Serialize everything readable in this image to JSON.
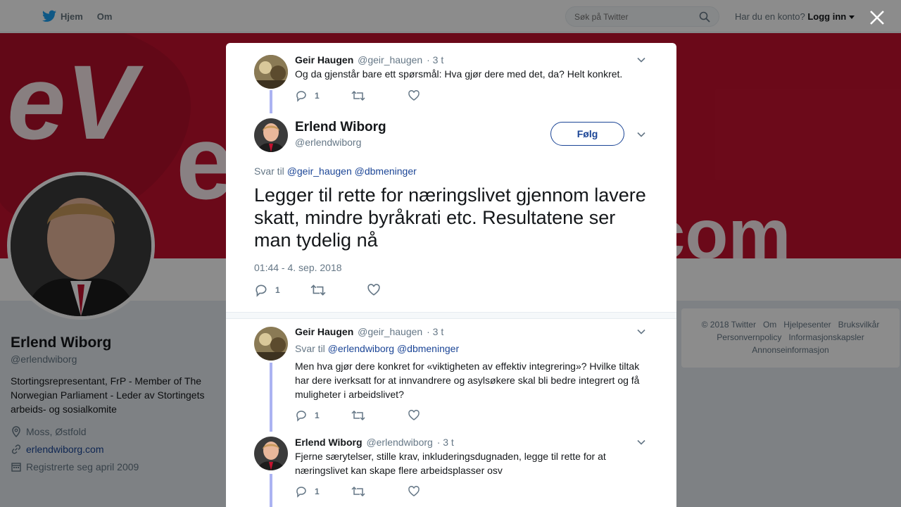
{
  "topbar": {
    "home_label": "Hjem",
    "about_label": "Om",
    "search_placeholder": "Søk på Twitter",
    "login_prompt": "Har du en konto?",
    "login_label": "Logg inn"
  },
  "banner": {
    "text": "eWiborg",
    "subtext": ".com"
  },
  "profile": {
    "name": "Erlend Wiborg",
    "handle": "@erlendwiborg",
    "bio": "Stortingsrepresentant, FrP - Member of The Norwegian Parliament - Leder av Stortingets arbeids- og sosialkomite",
    "location": "Moss, Østfold",
    "website": "erlendwiborg.com",
    "joined": "Registrerte seg april 2009"
  },
  "footer": {
    "links": [
      "© 2018 Twitter",
      "Om",
      "Hjelpesenter",
      "Bruksvilkår",
      "Personvernpolicy",
      "Informasjonskapsler",
      "Annonseinformasjon"
    ]
  },
  "modal": {
    "tweet1": {
      "name": "Geir Haugen",
      "handle": "@geir_haugen",
      "time": "· 3 t",
      "text": "Og da gjenstår bare ett spørsmål: Hva gjør dere med det, da? Helt konkret.",
      "replies": "1"
    },
    "main": {
      "name": "Erlend Wiborg",
      "handle": "@erlendwiborg",
      "follow_label": "Følg",
      "reply_prefix": "Svar til",
      "reply_to_1": "@geir_haugen",
      "reply_to_2": "@dbmeninger",
      "text": "Legger til rette for næringslivet gjennom lavere skatt, mindre byråkrati etc. Resultatene ser man tydelig nå",
      "timestamp": "01:44 - 4. sep. 2018",
      "replies": "1"
    },
    "tweet3": {
      "name": "Geir Haugen",
      "handle": "@geir_haugen",
      "time": "· 3 t",
      "reply_prefix": "Svar til",
      "reply_to_1": "@erlendwiborg",
      "reply_to_2": "@dbmeninger",
      "text": "Men hva gjør dere konkret for «viktigheten av effektiv integrering»? Hvilke tiltak har dere iverksatt for at innvandrere og asylsøkere skal bli bedre integrert og få muligheter i arbeidslivet?",
      "replies": "1"
    },
    "tweet4": {
      "name": "Erlend Wiborg",
      "handle": "@erlendwiborg",
      "time": "· 3 t",
      "text": "Fjerne særytelser, stille krav, inkluderingsdugnaden, legge til rette for at næringslivet kan skape flere arbeidsplasser osv",
      "replies": "1"
    }
  },
  "colors": {
    "brand_blue": "#1b4596",
    "thread_line": "#abb3f2",
    "banner_red": "#c4122f",
    "twitter_blue": "#1da1f2"
  }
}
